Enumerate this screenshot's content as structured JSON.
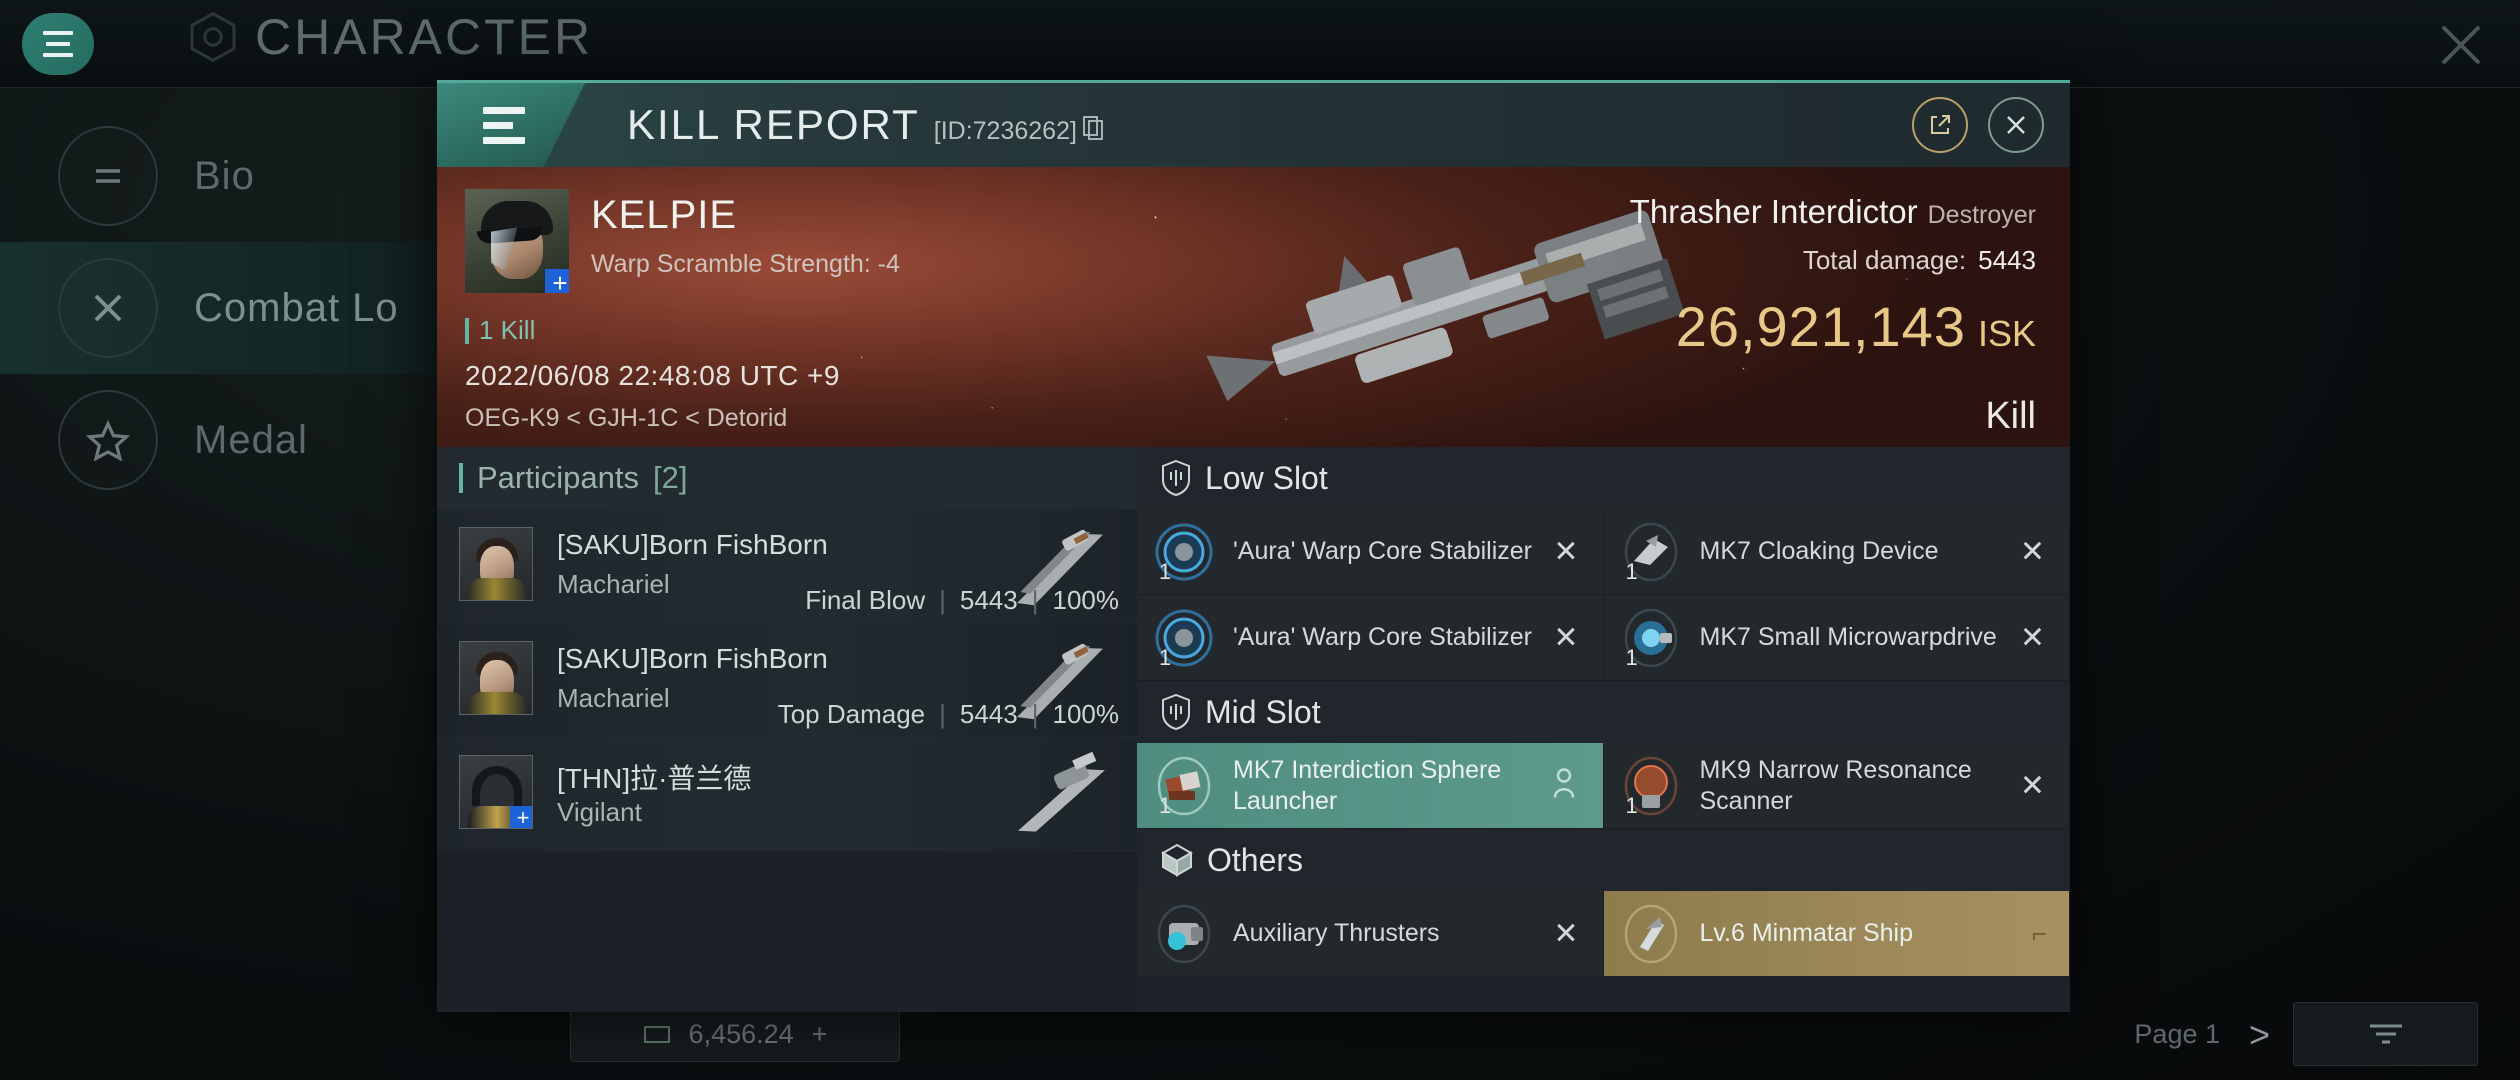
{
  "background": {
    "title": "CHARACTER",
    "menu_icon": "hamburger-icon",
    "close_icon": "close-icon",
    "sidebar": [
      {
        "label": "Bio",
        "icon": "lines-icon"
      },
      {
        "label": "Combat Lo",
        "icon": "crossed-swords-icon"
      },
      {
        "label": "Medal",
        "icon": "star-icon"
      }
    ],
    "bottom": {
      "value": "6,456.24",
      "page": "Page 1",
      "next": ">",
      "filter_icon": "filter-icon"
    }
  },
  "modal": {
    "menu_icon": "hamburger-icon",
    "title": "KILL REPORT",
    "id_label": "[ID:7236262]",
    "copy_icon": "copy-icon",
    "share_icon": "external-link-icon",
    "close_icon": "close-icon",
    "banner": {
      "victim_name": "KELPIE",
      "victim_sub": "Warp Scramble Strength: -4",
      "kill_count": "1 Kill",
      "timestamp": "2022/06/08 22:48:08 UTC +9",
      "location": "OEG-K9 < GJH-1C < Detorid",
      "ship_name": "Thrasher Interdictor",
      "ship_class": "Destroyer",
      "damage_label": "Total damage:",
      "damage_value": "5443",
      "isk_value": "26,921,143",
      "isk_unit": "ISK",
      "result": "Kill",
      "add_icon": "plus-badge-icon",
      "isk_color": "#e8c887",
      "accent_color": "#63b5a4"
    },
    "participants": {
      "heading": "Participants",
      "count": "[2]",
      "rows": [
        {
          "name": "[SAKU]Born FishBorn",
          "ship": "Machariel",
          "role": "Final Blow",
          "damage": "5443",
          "percent": "100%",
          "has_plus": false
        },
        {
          "name": "[SAKU]Born FishBorn",
          "ship": "Machariel",
          "role": "Top Damage",
          "damage": "5443",
          "percent": "100%",
          "has_plus": false
        },
        {
          "name": "[THN]拉·普兰德",
          "ship": "Vigilant",
          "role": "",
          "damage": "",
          "percent": "",
          "has_plus": true
        }
      ]
    },
    "slots": [
      {
        "title": "Low Slot",
        "icon": "shield-slot-icon",
        "modules": [
          {
            "qty": "1",
            "name": "'Aura' Warp Core Stabilizer",
            "icon": "warp-core-stabilizer-icon",
            "action": "x",
            "state": "normal"
          },
          {
            "qty": "1",
            "name": "MK7 Cloaking Device",
            "icon": "cloaking-device-icon",
            "action": "x",
            "state": "normal"
          },
          {
            "qty": "1",
            "name": "'Aura' Warp Core Stabilizer",
            "icon": "warp-core-stabilizer-icon",
            "action": "x",
            "state": "normal"
          },
          {
            "qty": "1",
            "name": "MK7 Small Microwarpdrive",
            "icon": "microwarpdrive-icon",
            "action": "x",
            "state": "normal"
          }
        ]
      },
      {
        "title": "Mid Slot",
        "icon": "shield-slot-icon",
        "modules": [
          {
            "qty": "1",
            "name": "MK7 Interdiction Sphere Launcher",
            "icon": "interdiction-launcher-icon",
            "action": "person",
            "state": "selected"
          },
          {
            "qty": "1",
            "name": "MK9 Narrow Resonance Scanner",
            "icon": "resonance-scanner-icon",
            "action": "x",
            "state": "normal"
          }
        ]
      },
      {
        "title": "Others",
        "icon": "cube-icon",
        "modules": [
          {
            "qty": "",
            "name": "Auxiliary Thrusters",
            "icon": "thruster-icon",
            "action": "x",
            "state": "normal"
          },
          {
            "qty": "",
            "name": "Lv.6 Minmatar Ship",
            "icon": "minmatar-ship-icon",
            "action": "gold",
            "state": "gold"
          }
        ]
      }
    ]
  }
}
